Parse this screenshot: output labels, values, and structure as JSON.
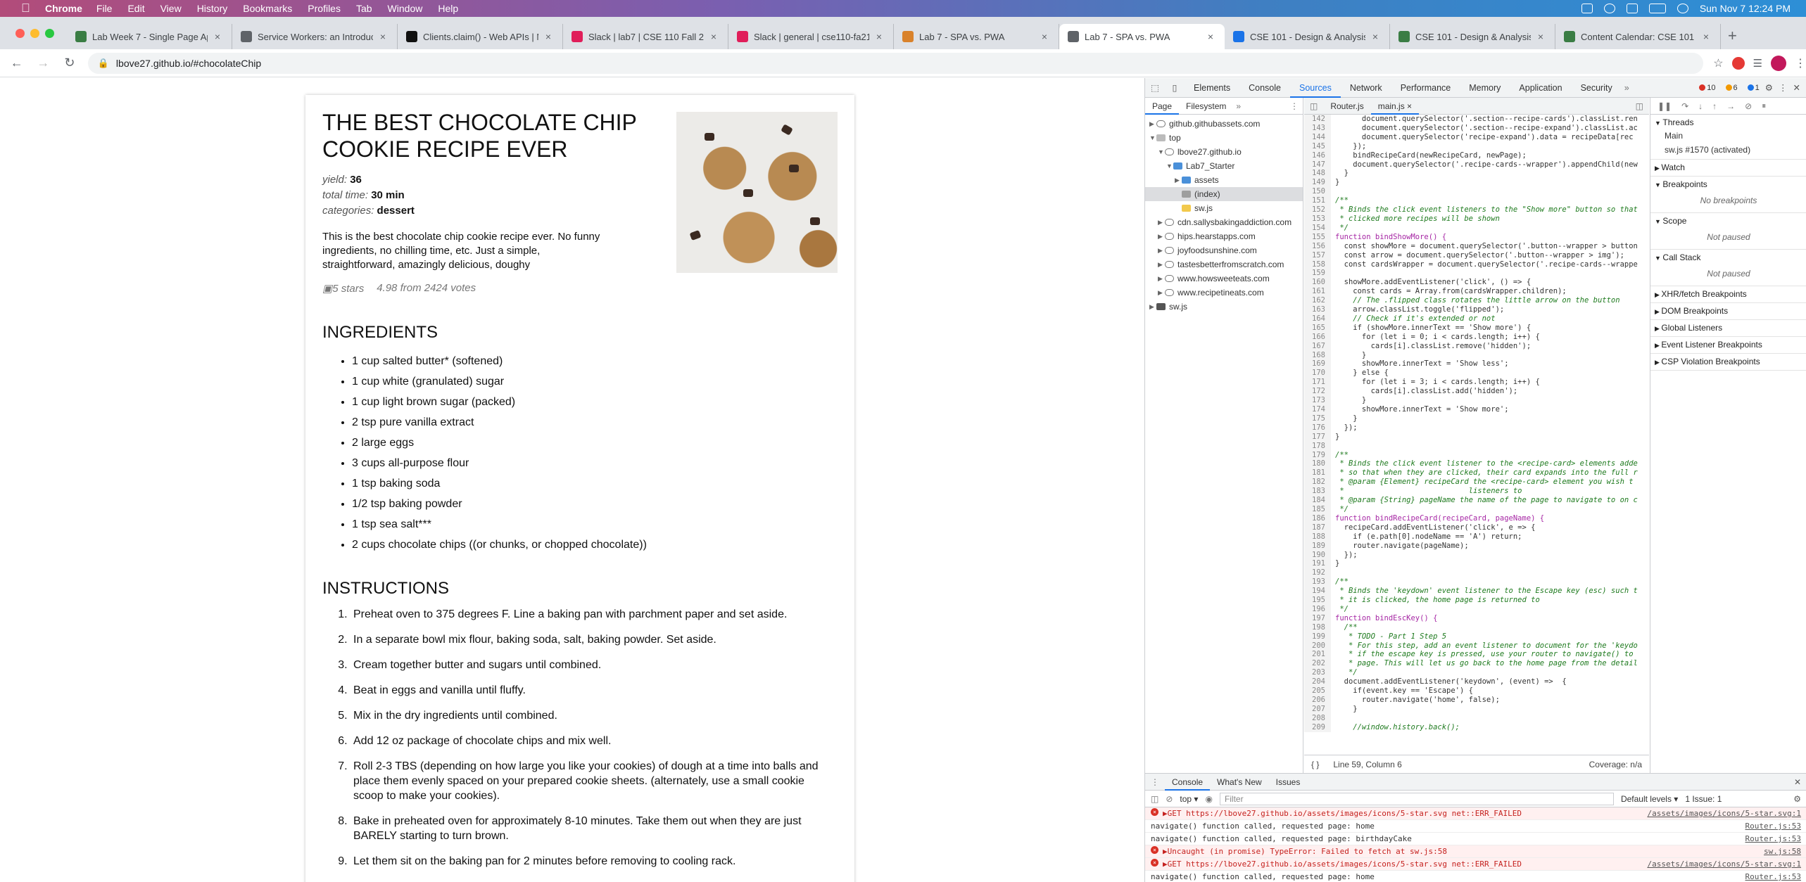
{
  "menubar": {
    "app": "Chrome",
    "items": [
      "File",
      "Edit",
      "View",
      "History",
      "Bookmarks",
      "Profiles",
      "Tab",
      "Window",
      "Help"
    ],
    "datetime": "Sun Nov 7  12:24 PM"
  },
  "tabs": [
    {
      "title": "Lab Week 7 - Single Page App",
      "color": "#3a7d44"
    },
    {
      "title": "Service Workers: an Introducti",
      "color": "#5f6368"
    },
    {
      "title": "Clients.claim() - Web APIs | M",
      "color": "#111"
    },
    {
      "title": "Slack | lab7 | CSE 110 Fall 21",
      "color": "#e01e5a"
    },
    {
      "title": "Slack | general | cse110-fa21-",
      "color": "#e01e5a"
    },
    {
      "title": "Lab 7 - SPA vs. PWA",
      "color": "#d9822b"
    },
    {
      "title": "Lab 7 - SPA vs. PWA",
      "color": "#5f6368",
      "active": true
    },
    {
      "title": "CSE 101 - Design & Analysis o",
      "color": "#1a73e8"
    },
    {
      "title": "CSE 101 - Design & Analysis o",
      "color": "#3a7d44"
    },
    {
      "title": "Content Calendar: CSE 101 - G",
      "color": "#3a7d44"
    }
  ],
  "address": {
    "url": "lbove27.github.io/#chocolateChip"
  },
  "recipe": {
    "title": "THE BEST CHOCOLATE CHIP COOKIE RECIPE EVER",
    "yield_label": "yield:",
    "yield": "36",
    "time_label": "total time:",
    "time": "30 min",
    "categories_label": "categories:",
    "categories": "dessert",
    "description": "This is the best chocolate chip cookie recipe ever. No funny ingredients, no chilling time, etc. Just a simple, straightforward, amazingly delicious, doughy",
    "stars_alt": "5 stars",
    "rating": "4.98 from 2424 votes",
    "ingredients_heading": "INGREDIENTS",
    "ingredients": [
      "1 cup salted butter* (softened)",
      "1 cup white (granulated) sugar",
      "1 cup light brown sugar (packed)",
      "2 tsp pure vanilla extract",
      "2 large eggs",
      "3 cups all-purpose flour",
      "1 tsp baking soda",
      "1/2 tsp baking powder",
      "1 tsp sea salt***",
      "2 cups chocolate chips ((or chunks, or chopped chocolate))"
    ],
    "instructions_heading": "INSTRUCTIONS",
    "instructions": [
      "Preheat oven to 375 degrees F. Line a baking pan with parchment paper and set aside.",
      "In a separate bowl mix flour, baking soda, salt, baking powder. Set aside.",
      "Cream together butter and sugars until combined.",
      "Beat in eggs and vanilla until fluffy.",
      "Mix in the dry ingredients until combined.",
      "Add 12 oz package of chocolate chips and mix well.",
      "Roll 2-3 TBS (depending on how large you like your cookies) of dough at a time into balls and place them evenly spaced on your prepared cookie sheets. (alternately, use a small cookie scoop to make your cookies).",
      "Bake in preheated oven for approximately 8-10 minutes. Take them out when they are just BARELY starting to turn brown.",
      "Let them sit on the baking pan for 2 minutes before removing to cooling rack."
    ]
  },
  "devtools": {
    "tabs": [
      "Elements",
      "Console",
      "Sources",
      "Network",
      "Performance",
      "Memory",
      "Application",
      "Security"
    ],
    "active_tab": "Sources",
    "errors": "10",
    "warnings": "6",
    "info": "1",
    "nav_tabs": [
      "Page",
      "Filesystem"
    ],
    "tree": [
      {
        "label": "github.githubassets.com",
        "depth": 0,
        "type": "cloud",
        "arrow": "▶"
      },
      {
        "label": "top",
        "depth": 0,
        "type": "frame",
        "arrow": "▼"
      },
      {
        "label": "lbove27.github.io",
        "depth": 1,
        "type": "cloud",
        "arrow": "▼"
      },
      {
        "label": "Lab7_Starter",
        "depth": 2,
        "type": "folder",
        "arrow": "▼"
      },
      {
        "label": "assets",
        "depth": 3,
        "type": "folder",
        "arrow": "▶"
      },
      {
        "label": "(index)",
        "depth": 3,
        "type": "file",
        "arrow": "",
        "selected": true
      },
      {
        "label": "sw.js",
        "depth": 3,
        "type": "js",
        "arrow": ""
      },
      {
        "label": "cdn.sallysbakingaddiction.com",
        "depth": 1,
        "type": "cloud",
        "arrow": "▶"
      },
      {
        "label": "hips.hearstapps.com",
        "depth": 1,
        "type": "cloud",
        "arrow": "▶"
      },
      {
        "label": "joyfoodsunshine.com",
        "depth": 1,
        "type": "cloud",
        "arrow": "▶"
      },
      {
        "label": "tastesbetterfromscratch.com",
        "depth": 1,
        "type": "cloud",
        "arrow": "▶"
      },
      {
        "label": "www.howsweeteats.com",
        "depth": 1,
        "type": "cloud",
        "arrow": "▶"
      },
      {
        "label": "www.recipetineats.com",
        "depth": 1,
        "type": "cloud",
        "arrow": "▶"
      },
      {
        "label": "sw.js",
        "depth": 0,
        "type": "gear",
        "arrow": "▶"
      }
    ],
    "editor_tabs": [
      "Router.js",
      "main.js"
    ],
    "code": [
      {
        "n": 142,
        "t": "      document.querySelector('.section--recipe-cards').classList.ren",
        "c": ""
      },
      {
        "n": 143,
        "t": "      document.querySelector('.section--recipe-expand').classList.ac",
        "c": ""
      },
      {
        "n": 144,
        "t": "      document.querySelector('recipe-expand').data = recipeData[rec",
        "c": ""
      },
      {
        "n": 145,
        "t": "    });",
        "c": ""
      },
      {
        "n": 146,
        "t": "    bindRecipeCard(newRecipeCard, newPage);",
        "c": ""
      },
      {
        "n": 147,
        "t": "    document.querySelector('.recipe-cards--wrapper').appendChild(new",
        "c": ""
      },
      {
        "n": 148,
        "t": "  }",
        "c": ""
      },
      {
        "n": 149,
        "t": "}",
        "c": ""
      },
      {
        "n": 150,
        "t": "",
        "c": ""
      },
      {
        "n": 151,
        "t": "/**",
        "c": "cm"
      },
      {
        "n": 152,
        "t": " * Binds the click event listeners to the \"Show more\" button so that",
        "c": "cm"
      },
      {
        "n": 153,
        "t": " * clicked more recipes will be shown",
        "c": "cm"
      },
      {
        "n": 154,
        "t": " */",
        "c": "cm"
      },
      {
        "n": 155,
        "t": "function bindShowMore() {",
        "c": "kw"
      },
      {
        "n": 156,
        "t": "  const showMore = document.querySelector('.button--wrapper > button",
        "c": ""
      },
      {
        "n": 157,
        "t": "  const arrow = document.querySelector('.button--wrapper > img');",
        "c": ""
      },
      {
        "n": 158,
        "t": "  const cardsWrapper = document.querySelector('.recipe-cards--wrappe",
        "c": ""
      },
      {
        "n": 159,
        "t": "",
        "c": ""
      },
      {
        "n": 160,
        "t": "  showMore.addEventListener('click', () => {",
        "c": ""
      },
      {
        "n": 161,
        "t": "    const cards = Array.from(cardsWrapper.children);",
        "c": ""
      },
      {
        "n": 162,
        "t": "    // The .flipped class rotates the little arrow on the button",
        "c": "cm"
      },
      {
        "n": 163,
        "t": "    arrow.classList.toggle('flipped');",
        "c": ""
      },
      {
        "n": 164,
        "t": "    // Check if it's extended or not",
        "c": "cm"
      },
      {
        "n": 165,
        "t": "    if (showMore.innerText == 'Show more') {",
        "c": ""
      },
      {
        "n": 166,
        "t": "      for (let i = 0; i < cards.length; i++) {",
        "c": ""
      },
      {
        "n": 167,
        "t": "        cards[i].classList.remove('hidden');",
        "c": ""
      },
      {
        "n": 168,
        "t": "      }",
        "c": ""
      },
      {
        "n": 169,
        "t": "      showMore.innerText = 'Show less';",
        "c": ""
      },
      {
        "n": 170,
        "t": "    } else {",
        "c": ""
      },
      {
        "n": 171,
        "t": "      for (let i = 3; i < cards.length; i++) {",
        "c": ""
      },
      {
        "n": 172,
        "t": "        cards[i].classList.add('hidden');",
        "c": ""
      },
      {
        "n": 173,
        "t": "      }",
        "c": ""
      },
      {
        "n": 174,
        "t": "      showMore.innerText = 'Show more';",
        "c": ""
      },
      {
        "n": 175,
        "t": "    }",
        "c": ""
      },
      {
        "n": 176,
        "t": "  });",
        "c": ""
      },
      {
        "n": 177,
        "t": "}",
        "c": ""
      },
      {
        "n": 178,
        "t": "",
        "c": ""
      },
      {
        "n": 179,
        "t": "/**",
        "c": "cm"
      },
      {
        "n": 180,
        "t": " * Binds the click event listener to the <recipe-card> elements adde",
        "c": "cm"
      },
      {
        "n": 181,
        "t": " * so that when they are clicked, their card expands into the full r",
        "c": "cm"
      },
      {
        "n": 182,
        "t": " * @param {Element} recipeCard the <recipe-card> element you wish t",
        "c": "cm"
      },
      {
        "n": 183,
        "t": " *                            listeners to",
        "c": "cm"
      },
      {
        "n": 184,
        "t": " * @param {String} pageName the name of the page to navigate to on c",
        "c": "cm"
      },
      {
        "n": 185,
        "t": " */",
        "c": "cm"
      },
      {
        "n": 186,
        "t": "function bindRecipeCard(recipeCard, pageName) {",
        "c": "kw"
      },
      {
        "n": 187,
        "t": "  recipeCard.addEventListener('click', e => {",
        "c": ""
      },
      {
        "n": 188,
        "t": "    if (e.path[0].nodeName == 'A') return;",
        "c": ""
      },
      {
        "n": 189,
        "t": "    router.navigate(pageName);",
        "c": ""
      },
      {
        "n": 190,
        "t": "  });",
        "c": ""
      },
      {
        "n": 191,
        "t": "}",
        "c": ""
      },
      {
        "n": 192,
        "t": "",
        "c": ""
      },
      {
        "n": 193,
        "t": "/**",
        "c": "cm"
      },
      {
        "n": 194,
        "t": " * Binds the 'keydown' event listener to the Escape key (esc) such t",
        "c": "cm"
      },
      {
        "n": 195,
        "t": " * it is clicked, the home page is returned to",
        "c": "cm"
      },
      {
        "n": 196,
        "t": " */",
        "c": "cm"
      },
      {
        "n": 197,
        "t": "function bindEscKey() {",
        "c": "kw"
      },
      {
        "n": 198,
        "t": "  /**",
        "c": "cm"
      },
      {
        "n": 199,
        "t": "   * TODO - Part 1 Step 5",
        "c": "cm"
      },
      {
        "n": 200,
        "t": "   * For this step, add an event listener to document for the 'keydo",
        "c": "cm"
      },
      {
        "n": 201,
        "t": "   * if the escape key is pressed, use your router to navigate() to",
        "c": "cm"
      },
      {
        "n": 202,
        "t": "   * page. This will let us go back to the home page from the detail",
        "c": "cm"
      },
      {
        "n": 203,
        "t": "   */",
        "c": "cm"
      },
      {
        "n": 204,
        "t": "  document.addEventListener('keydown', (event) =>  {",
        "c": ""
      },
      {
        "n": 205,
        "t": "    if(event.key == 'Escape') {",
        "c": ""
      },
      {
        "n": 206,
        "t": "      router.navigate('home', false);",
        "c": ""
      },
      {
        "n": 207,
        "t": "    }",
        "c": ""
      },
      {
        "n": 208,
        "t": "",
        "c": ""
      },
      {
        "n": 209,
        "t": "    //window.history.back();",
        "c": "cm"
      }
    ],
    "cursor": "Line 59, Column 6",
    "coverage": "Coverage: n/a",
    "debug_sections": [
      {
        "title": "Threads",
        "open": true,
        "items": [
          "Main",
          "sw.js #1570 (activated)"
        ]
      },
      {
        "title": "Watch",
        "open": false,
        "items": []
      },
      {
        "title": "Breakpoints",
        "open": true,
        "note": "No breakpoints"
      },
      {
        "title": "Scope",
        "open": true,
        "note": "Not paused"
      },
      {
        "title": "Call Stack",
        "open": true,
        "note": "Not paused"
      },
      {
        "title": "XHR/fetch Breakpoints",
        "open": false
      },
      {
        "title": "DOM Breakpoints",
        "open": false
      },
      {
        "title": "Global Listeners",
        "open": false
      },
      {
        "title": "Event Listener Breakpoints",
        "open": false
      },
      {
        "title": "CSP Violation Breakpoints",
        "open": false
      }
    ],
    "drawer_tabs": [
      "Console",
      "What's New",
      "Issues"
    ],
    "context": "top",
    "filter_placeholder": "Filter",
    "levels": "Default levels ▾",
    "issues": "1 Issue: 1",
    "console": [
      {
        "type": "err",
        "text": "▶GET https://lbove27.github.io/assets/images/icons/5-star.svg net::ERR_FAILED",
        "src": "/assets/images/icons/5-star.svg:1"
      },
      {
        "type": "log",
        "text": "navigate() function called, requested page: home",
        "src": "Router.js:53"
      },
      {
        "type": "log",
        "text": "navigate() function called, requested page: birthdayCake",
        "src": "Router.js:53"
      },
      {
        "type": "err",
        "text": "▶Uncaught (in promise) TypeError: Failed to fetch      at sw.js:58",
        "src": "sw.js:58"
      },
      {
        "type": "err",
        "text": "▶GET https://lbove27.github.io/assets/images/icons/5-star.svg net::ERR_FAILED",
        "src": "/assets/images/icons/5-star.svg:1"
      },
      {
        "type": "log",
        "text": "navigate() function called, requested page: home",
        "src": "Router.js:53"
      }
    ]
  }
}
